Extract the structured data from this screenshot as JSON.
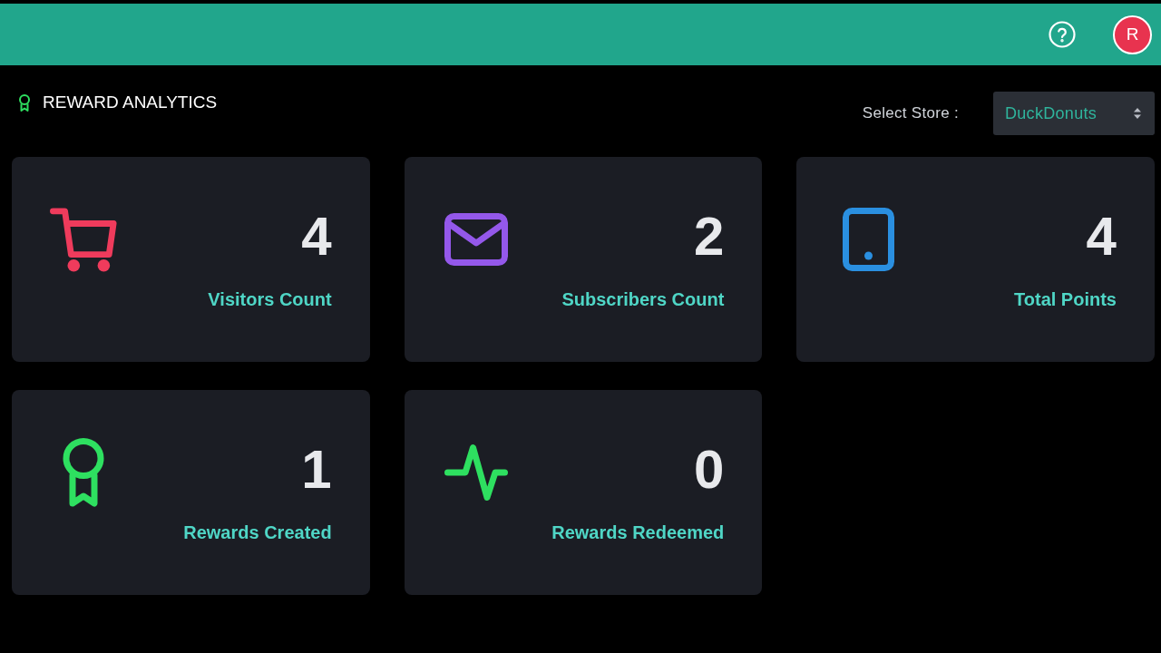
{
  "header": {
    "avatar": {
      "initial": "R"
    }
  },
  "page": {
    "title": "REWARD ANALYTICS"
  },
  "store_select": {
    "label": "Select Store :",
    "value": "DuckDonuts"
  },
  "cards": [
    {
      "kind": "cart",
      "color": "#ef3b5c",
      "value": "4",
      "label": "Visitors Count"
    },
    {
      "kind": "mail",
      "color": "#9458ea",
      "value": "2",
      "label": "Subscribers Count"
    },
    {
      "kind": "tablet",
      "color": "#2a8fe0",
      "value": "4",
      "label": "Total Points"
    },
    {
      "kind": "award",
      "color": "#2ee060",
      "value": "1",
      "label": "Rewards Created"
    },
    {
      "kind": "activity",
      "color": "#2ee060",
      "value": "0",
      "label": "Rewards Redeemed"
    }
  ]
}
